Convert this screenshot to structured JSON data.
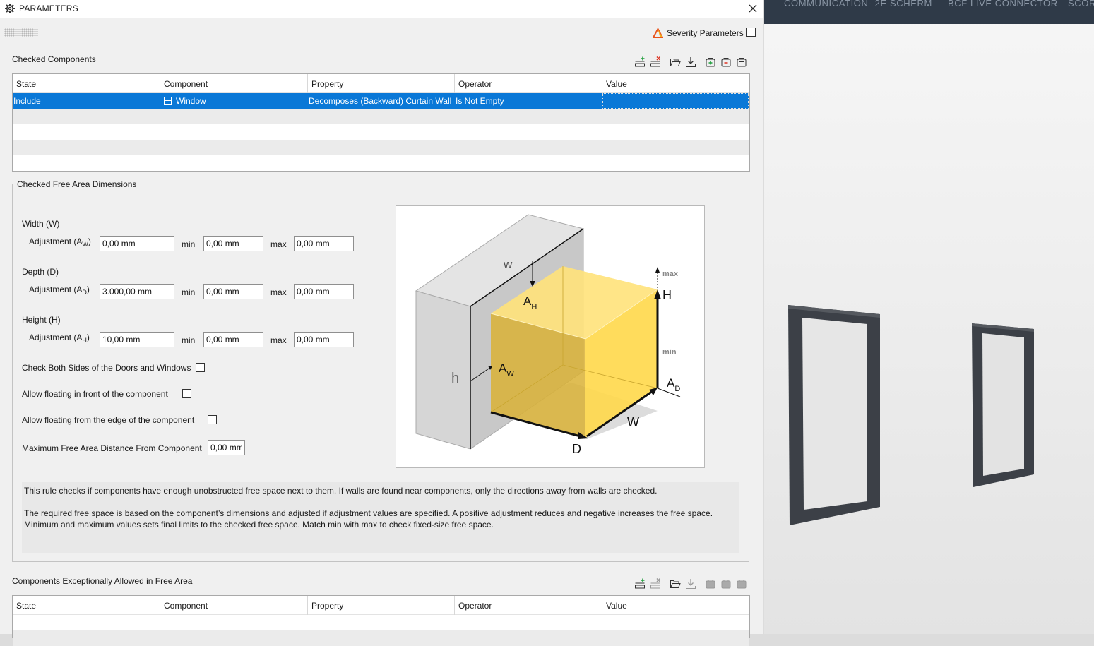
{
  "window": {
    "title": "PARAMETERS"
  },
  "severity": {
    "label": "Severity Parameters"
  },
  "checked_components": {
    "label": "Checked Components",
    "columns": [
      "State",
      "Component",
      "Property",
      "Operator",
      "Value"
    ],
    "rows": [
      {
        "state": "Include",
        "component": "Window",
        "property": "Decomposes (Backward) Curtain Wall",
        "operator": "Is Not Empty",
        "value": ""
      }
    ]
  },
  "free_area": {
    "title": "Checked Free Area Dimensions",
    "width": {
      "label": "Width (W)",
      "adj_label": "Adjustment (A",
      "adj_sub": "W",
      "adj_value": "0,00 mm",
      "min_label": "min",
      "min_value": "0,00 mm",
      "max_label": "max",
      "max_value": "0,00 mm"
    },
    "depth": {
      "label": "Depth (D)",
      "adj_label": "Adjustment (A",
      "adj_sub": "D",
      "adj_value": "3.000,00 mm",
      "min_label": "min",
      "min_value": "0,00 mm",
      "max_label": "max",
      "max_value": "0,00 mm"
    },
    "height": {
      "label": "Height (H)",
      "adj_label": "Adjustment (A",
      "adj_sub": "H",
      "adj_value": "10,00 mm",
      "min_label": "min",
      "min_value": "0,00 mm",
      "max_label": "max",
      "max_value": "0,00 mm"
    },
    "check_both_sides": {
      "label": "Check Both Sides of the Doors and Windows",
      "checked": false
    },
    "allow_floating_front": {
      "label": "Allow floating in front of the component",
      "checked": false
    },
    "allow_floating_edge": {
      "label": "Allow floating from the edge of the component",
      "checked": false
    },
    "max_distance": {
      "label": "Maximum Free Area Distance From Component",
      "value": "0,00 mm"
    },
    "description": {
      "p1": "This rule checks if components have enough unobstructed free space next to them. If walls are found near components, only the directions away from walls are checked.",
      "p2": "The required free space is based on the component’s dimensions and adjusted if adjustment values are specified. A positive adjustment reduces and negative increases the free space.",
      "p3": "Minimum and maximum values sets final limits to the checked free space. Match min with max to check fixed-size free space."
    },
    "diagram_labels": {
      "w": "w",
      "ah": "A",
      "ah_sub": "H",
      "h_small": "h",
      "aw": "A",
      "aw_sub": "W",
      "max": "max",
      "min": "min",
      "H": "H",
      "ad": "A",
      "ad_sub": "D",
      "W": "W",
      "D": "D"
    }
  },
  "exceptions": {
    "label": "Components Exceptionally Allowed in Free Area",
    "columns": [
      "State",
      "Component",
      "Property",
      "Operator",
      "Value"
    ]
  },
  "viewport": {
    "tabs": [
      "COMMUNICATION- 2E SCHERM",
      "BCF LIVE CONNECTOR",
      "SCOR"
    ]
  },
  "colors": {
    "selection": "#0a78d7",
    "free_area": "#ffd84a",
    "topbar": "#2f3a48",
    "frame": "#3c4047"
  }
}
